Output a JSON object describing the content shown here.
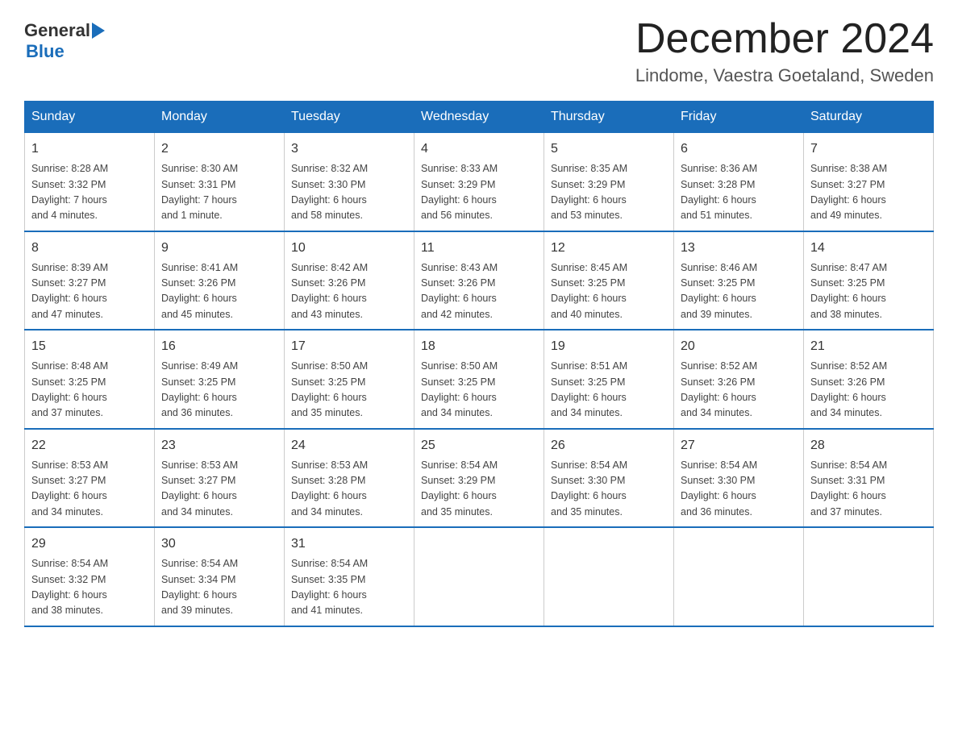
{
  "logo": {
    "general": "General",
    "blue": "Blue"
  },
  "title": "December 2024",
  "location": "Lindome, Vaestra Goetaland, Sweden",
  "days_of_week": [
    "Sunday",
    "Monday",
    "Tuesday",
    "Wednesday",
    "Thursday",
    "Friday",
    "Saturday"
  ],
  "weeks": [
    [
      {
        "day": "1",
        "info": "Sunrise: 8:28 AM\nSunset: 3:32 PM\nDaylight: 7 hours\nand 4 minutes."
      },
      {
        "day": "2",
        "info": "Sunrise: 8:30 AM\nSunset: 3:31 PM\nDaylight: 7 hours\nand 1 minute."
      },
      {
        "day": "3",
        "info": "Sunrise: 8:32 AM\nSunset: 3:30 PM\nDaylight: 6 hours\nand 58 minutes."
      },
      {
        "day": "4",
        "info": "Sunrise: 8:33 AM\nSunset: 3:29 PM\nDaylight: 6 hours\nand 56 minutes."
      },
      {
        "day": "5",
        "info": "Sunrise: 8:35 AM\nSunset: 3:29 PM\nDaylight: 6 hours\nand 53 minutes."
      },
      {
        "day": "6",
        "info": "Sunrise: 8:36 AM\nSunset: 3:28 PM\nDaylight: 6 hours\nand 51 minutes."
      },
      {
        "day": "7",
        "info": "Sunrise: 8:38 AM\nSunset: 3:27 PM\nDaylight: 6 hours\nand 49 minutes."
      }
    ],
    [
      {
        "day": "8",
        "info": "Sunrise: 8:39 AM\nSunset: 3:27 PM\nDaylight: 6 hours\nand 47 minutes."
      },
      {
        "day": "9",
        "info": "Sunrise: 8:41 AM\nSunset: 3:26 PM\nDaylight: 6 hours\nand 45 minutes."
      },
      {
        "day": "10",
        "info": "Sunrise: 8:42 AM\nSunset: 3:26 PM\nDaylight: 6 hours\nand 43 minutes."
      },
      {
        "day": "11",
        "info": "Sunrise: 8:43 AM\nSunset: 3:26 PM\nDaylight: 6 hours\nand 42 minutes."
      },
      {
        "day": "12",
        "info": "Sunrise: 8:45 AM\nSunset: 3:25 PM\nDaylight: 6 hours\nand 40 minutes."
      },
      {
        "day": "13",
        "info": "Sunrise: 8:46 AM\nSunset: 3:25 PM\nDaylight: 6 hours\nand 39 minutes."
      },
      {
        "day": "14",
        "info": "Sunrise: 8:47 AM\nSunset: 3:25 PM\nDaylight: 6 hours\nand 38 minutes."
      }
    ],
    [
      {
        "day": "15",
        "info": "Sunrise: 8:48 AM\nSunset: 3:25 PM\nDaylight: 6 hours\nand 37 minutes."
      },
      {
        "day": "16",
        "info": "Sunrise: 8:49 AM\nSunset: 3:25 PM\nDaylight: 6 hours\nand 36 minutes."
      },
      {
        "day": "17",
        "info": "Sunrise: 8:50 AM\nSunset: 3:25 PM\nDaylight: 6 hours\nand 35 minutes."
      },
      {
        "day": "18",
        "info": "Sunrise: 8:50 AM\nSunset: 3:25 PM\nDaylight: 6 hours\nand 34 minutes."
      },
      {
        "day": "19",
        "info": "Sunrise: 8:51 AM\nSunset: 3:25 PM\nDaylight: 6 hours\nand 34 minutes."
      },
      {
        "day": "20",
        "info": "Sunrise: 8:52 AM\nSunset: 3:26 PM\nDaylight: 6 hours\nand 34 minutes."
      },
      {
        "day": "21",
        "info": "Sunrise: 8:52 AM\nSunset: 3:26 PM\nDaylight: 6 hours\nand 34 minutes."
      }
    ],
    [
      {
        "day": "22",
        "info": "Sunrise: 8:53 AM\nSunset: 3:27 PM\nDaylight: 6 hours\nand 34 minutes."
      },
      {
        "day": "23",
        "info": "Sunrise: 8:53 AM\nSunset: 3:27 PM\nDaylight: 6 hours\nand 34 minutes."
      },
      {
        "day": "24",
        "info": "Sunrise: 8:53 AM\nSunset: 3:28 PM\nDaylight: 6 hours\nand 34 minutes."
      },
      {
        "day": "25",
        "info": "Sunrise: 8:54 AM\nSunset: 3:29 PM\nDaylight: 6 hours\nand 35 minutes."
      },
      {
        "day": "26",
        "info": "Sunrise: 8:54 AM\nSunset: 3:30 PM\nDaylight: 6 hours\nand 35 minutes."
      },
      {
        "day": "27",
        "info": "Sunrise: 8:54 AM\nSunset: 3:30 PM\nDaylight: 6 hours\nand 36 minutes."
      },
      {
        "day": "28",
        "info": "Sunrise: 8:54 AM\nSunset: 3:31 PM\nDaylight: 6 hours\nand 37 minutes."
      }
    ],
    [
      {
        "day": "29",
        "info": "Sunrise: 8:54 AM\nSunset: 3:32 PM\nDaylight: 6 hours\nand 38 minutes."
      },
      {
        "day": "30",
        "info": "Sunrise: 8:54 AM\nSunset: 3:34 PM\nDaylight: 6 hours\nand 39 minutes."
      },
      {
        "day": "31",
        "info": "Sunrise: 8:54 AM\nSunset: 3:35 PM\nDaylight: 6 hours\nand 41 minutes."
      },
      {
        "day": "",
        "info": ""
      },
      {
        "day": "",
        "info": ""
      },
      {
        "day": "",
        "info": ""
      },
      {
        "day": "",
        "info": ""
      }
    ]
  ]
}
